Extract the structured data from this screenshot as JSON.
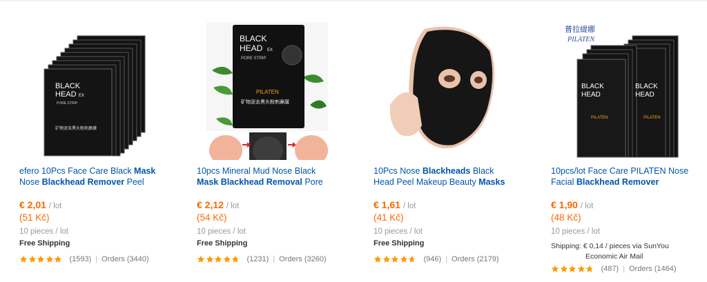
{
  "colors": {
    "accent": "#ff6600",
    "link": "#0055aa",
    "star": "#ff9900"
  },
  "products": [
    {
      "title_parts": [
        {
          "text": "efero 10Pcs Face Care Black ",
          "bold": false
        },
        {
          "text": "Mask",
          "bold": true
        },
        {
          "text": " Nose ",
          "bold": false
        },
        {
          "text": "Blackhead Remover",
          "bold": true
        },
        {
          "text": " Peel",
          "bold": false
        }
      ],
      "price": "€ 2,01",
      "price_unit": "/ lot",
      "local_price": "(51 Kč)",
      "pieces": "10 pieces / lot",
      "shipping": "Free Shipping",
      "rating_value": 4.9,
      "reviews": "(1593)",
      "separator": "|",
      "orders": "Orders (3440)"
    },
    {
      "title_parts": [
        {
          "text": "10pcs Mineral Mud Nose Black ",
          "bold": false
        },
        {
          "text": "Mask Blackhead Removal",
          "bold": true
        },
        {
          "text": " Pore",
          "bold": false
        }
      ],
      "price": "€ 2,12",
      "price_unit": "/ lot",
      "local_price": "(54 Kč)",
      "pieces": "10 pieces / lot",
      "shipping": "Free Shipping",
      "rating_value": 4.8,
      "reviews": "(1231)",
      "separator": "|",
      "orders": "Orders (3260)"
    },
    {
      "title_parts": [
        {
          "text": "10Pcs Nose ",
          "bold": false
        },
        {
          "text": "Blackheads",
          "bold": true
        },
        {
          "text": " Black Head Peel Makeup Beauty ",
          "bold": false
        },
        {
          "text": "Masks",
          "bold": true
        }
      ],
      "price": "€ 1,61",
      "price_unit": "/ lot",
      "local_price": "(41 Kč)",
      "pieces": "10 pieces / lot",
      "shipping": "Free Shipping",
      "rating_value": 4.7,
      "reviews": "(946)",
      "separator": "|",
      "orders": "Orders (2179)"
    },
    {
      "title_parts": [
        {
          "text": "10pcs/lot Face Care PILATEN Nose Facial ",
          "bold": false
        },
        {
          "text": "Blackhead Remover",
          "bold": true
        }
      ],
      "price": "€ 1,90",
      "price_unit": "/ lot",
      "local_price": "(48 Kč)",
      "pieces": "10 pieces / lot",
      "shipping_line1": "Shipping: € 0,14 / pieces via SunYou",
      "shipping_line2": "Economic Air Mail",
      "rating_value": 4.8,
      "reviews": "(487)",
      "separator": "|",
      "orders": "Orders (1464)"
    }
  ],
  "image_text": {
    "strip_line1": "BLACK",
    "strip_line2": "HEAD",
    "strip_sub": "PORE STRIP",
    "strip_ex": "EX",
    "brand": "PILATEN",
    "brand_cn": "普拉缇娜",
    "cn_label": "矿物泥去黑头粉刺鼻膜"
  }
}
